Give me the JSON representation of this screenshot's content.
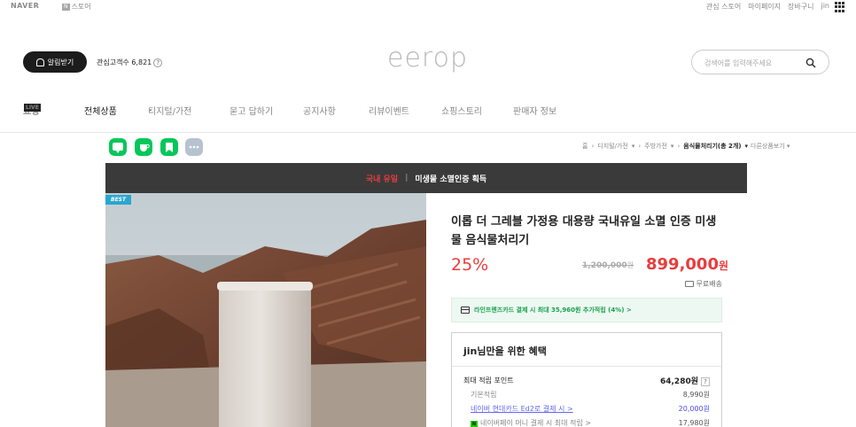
{
  "topbar": {
    "naver": "NAVER",
    "nstore_badge": "N",
    "nstore_label": "스토어",
    "links": [
      "관심 스토어",
      "마이페이지",
      "장바구니",
      "jin"
    ]
  },
  "header": {
    "alarm_label": "알림받기",
    "interest_label": "관심고객수 6,821",
    "interest_help": "?",
    "logo": "eerop",
    "search_placeholder": "검색어를 입력해주세요"
  },
  "nav": {
    "live_prefix": "쇼핑",
    "live_badge": "LIVE",
    "items": [
      "전체상품",
      "디지털/가전",
      "묻고 답하기",
      "공지사항",
      "리뷰이벤트",
      "쇼핑스토리",
      "판매자 정보"
    ]
  },
  "breadcrumb": {
    "items": [
      "홈",
      "디지털/가전",
      "주방가전",
      "음식물처리기(총 2개)",
      "다른상품보기"
    ]
  },
  "banner": {
    "red_text": "국내 유일",
    "separator": "|",
    "white_text": "미생물 소멸인증 획득"
  },
  "product": {
    "badge": "BEST",
    "title": "이롭 더 그레블 가정용 대용량 국내유일 소멸 인증 미생물 음식물처리기",
    "discount": "25%",
    "original_price": "1,200,000",
    "original_unit": "원",
    "sale_price": "899,000",
    "sale_unit": "원",
    "shipping": "무료배송",
    "card_promo": "라인프렌즈카드 결제 시 최대 35,960원 추가적립 (4%) >"
  },
  "benefits": {
    "title": "jin님만을 위한 혜택",
    "rows": [
      {
        "label": "최대 적립 포인트",
        "value": "64,280원"
      },
      {
        "label": "기본적립",
        "value": "8,990원"
      },
      {
        "label": "네이버 현대카드 Ed2로 결제 시 >",
        "value": "20,000원"
      },
      {
        "label": "네이버페이 머니 결제 시 최대 적립 >",
        "value": "17,980원"
      }
    ],
    "help": "?"
  },
  "colors": {
    "accent_red": "#e83d3d",
    "green": "#16a34a",
    "naver_green": "#03c75a",
    "banner_bg": "#3a3a3a",
    "best_badge": "#2aa6cf"
  }
}
